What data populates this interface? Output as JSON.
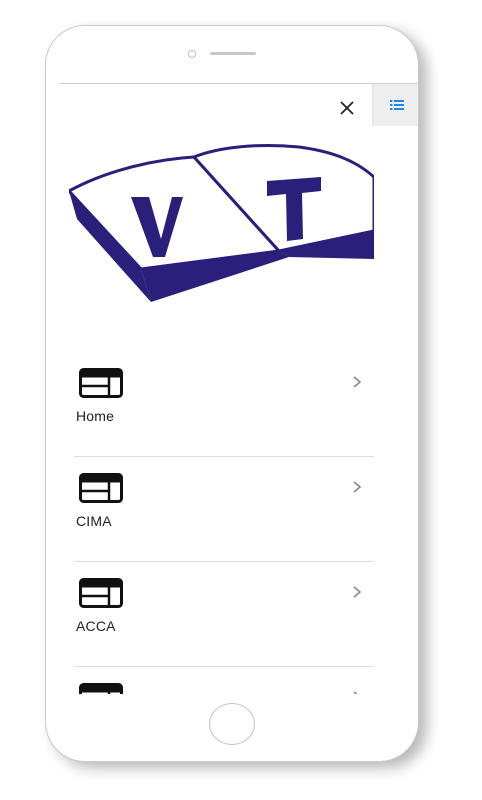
{
  "header": {
    "close_icon": "close-icon",
    "toggle_icon": "list-icon"
  },
  "logo": {
    "text": "VT",
    "brand_color": "#2a1f7a"
  },
  "menu": {
    "items": [
      {
        "label": "Home",
        "icon": "layout-icon"
      },
      {
        "label": "CIMA",
        "icon": "layout-icon"
      },
      {
        "label": "ACCA",
        "icon": "layout-icon"
      },
      {
        "label": "",
        "icon": "layout-icon"
      }
    ]
  },
  "colors": {
    "accent": "#1e88e5",
    "text": "#222222"
  }
}
